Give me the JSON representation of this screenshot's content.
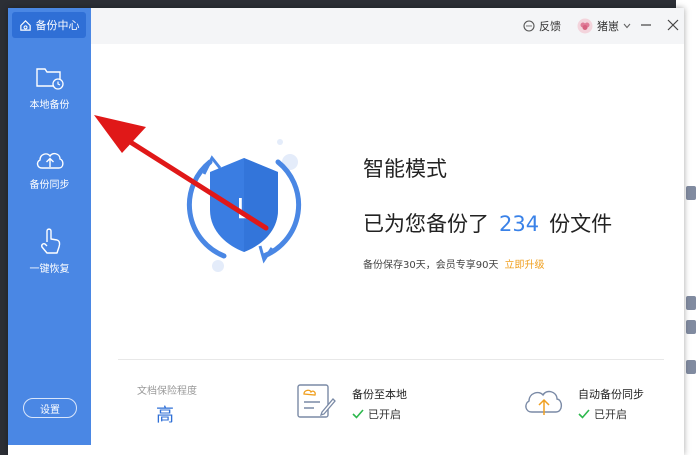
{
  "sidebar": {
    "title": "备份中心",
    "items": [
      {
        "label": "本地备份",
        "icon": "folder-clock-icon"
      },
      {
        "label": "备份同步",
        "icon": "cloud-upload-icon"
      },
      {
        "label": "一键恢复",
        "icon": "hand-pointer-icon"
      }
    ],
    "settings_label": "设置"
  },
  "titlebar": {
    "feedback_label": "反馈",
    "username": "猪崽"
  },
  "main": {
    "mode": "智能模式",
    "summary_prefix": "已为您备份了",
    "count": "234",
    "summary_suffix": "份文件",
    "note": "备份保存30天，会员专享90天",
    "upgrade_link": "立即升级",
    "shield_letter": "L"
  },
  "footer": {
    "level_label": "文档保险程度",
    "level_value": "高",
    "local": {
      "title": "备份至本地",
      "state": "已开启"
    },
    "sync": {
      "title": "自动备份同步",
      "state": "已开启"
    }
  },
  "colors": {
    "accent": "#4a87e4",
    "count": "#3a82e8",
    "link": "#f0a020",
    "check": "#2db84d",
    "arrow": "#e01818"
  }
}
